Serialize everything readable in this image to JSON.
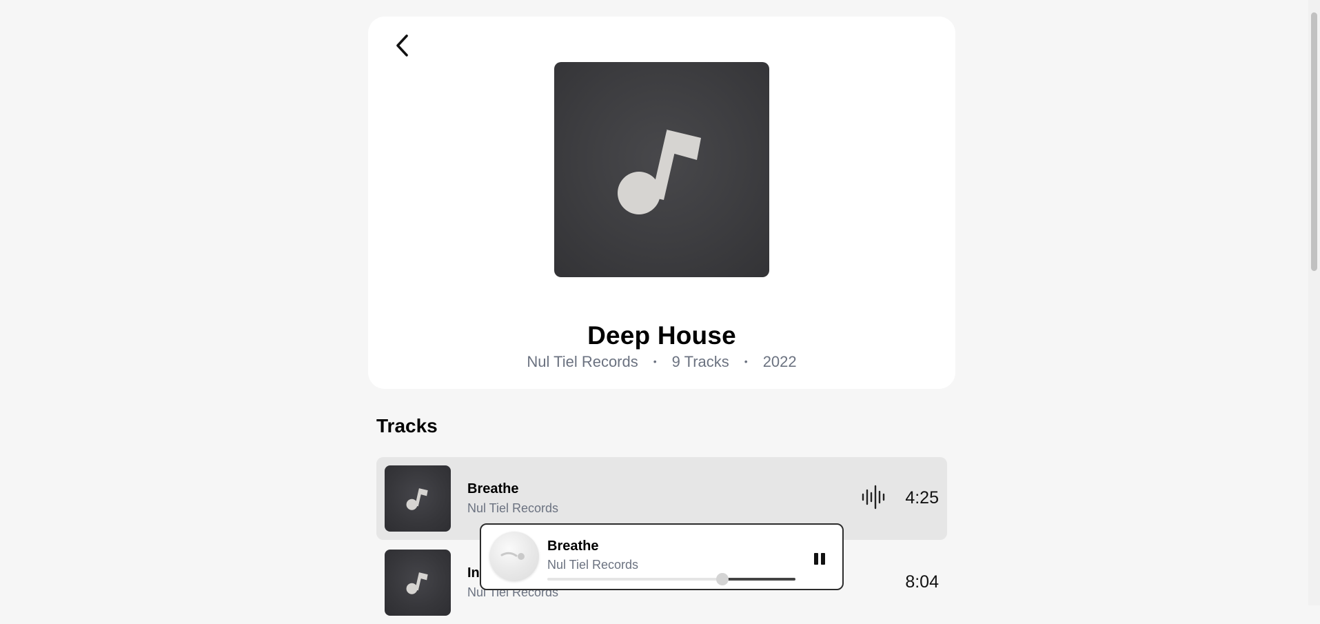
{
  "album": {
    "title": "Deep House",
    "label": "Nul Tiel Records",
    "track_count": "9 Tracks",
    "year": "2022",
    "separator": "•",
    "cover_icon": "music-note-icon"
  },
  "navigation": {
    "back_icon": "chevron-left-icon"
  },
  "tracks_section": {
    "heading": "Tracks",
    "items": [
      {
        "title": "Breathe",
        "artist": "Nul Tiel Records",
        "duration": "4:25",
        "playing": true,
        "status_icon": "audio-waveform-icon"
      },
      {
        "title": "In",
        "artist": "Nul Tiel Records",
        "duration": "8:04",
        "playing": false
      }
    ]
  },
  "now_playing": {
    "title": "Breathe",
    "artist": "Nul Tiel Records",
    "progress": 0.705,
    "control_icon": "pause-icon"
  },
  "colors": {
    "page_background": "#f6f6f6",
    "card_background": "#ffffff",
    "active_row": "#e6e6e6",
    "muted_text": "#6b7280",
    "cover_dark": "#3d3d40",
    "note_fill": "#d6d4d1"
  }
}
